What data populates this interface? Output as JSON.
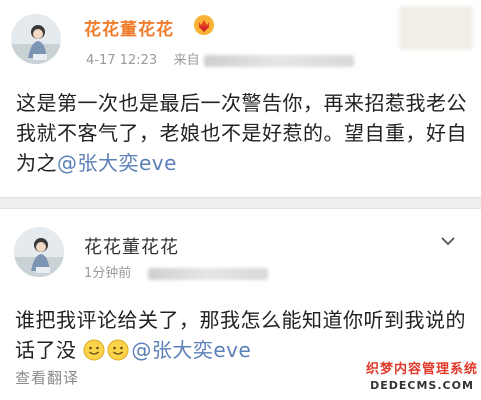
{
  "post": {
    "username": "花花董花花",
    "badge_icon": "vip-crown-heart-icon",
    "time": "4-17 12:23",
    "source_prefix": "来自",
    "content_text": "这是第一次也是最后一次警告你，再来招惹我老公我就不客气了，老娘也不是好惹的。望自重，好自为之",
    "mention": "@张大奕eve"
  },
  "comment": {
    "username": "花花董花花",
    "time": "1分钟前",
    "content_text": "谁把我评论给关了，那我怎么能知道你听到我说的话了没",
    "mention": "@张大奕eve",
    "translate_label": "查看翻译"
  },
  "watermark": {
    "line1": "织梦内容管理系统",
    "line2": "DEDECMS.COM"
  },
  "colors": {
    "username_orange": "#f07c2b",
    "mention_blue": "#5b7fb7",
    "separator": "#eeeeee"
  }
}
